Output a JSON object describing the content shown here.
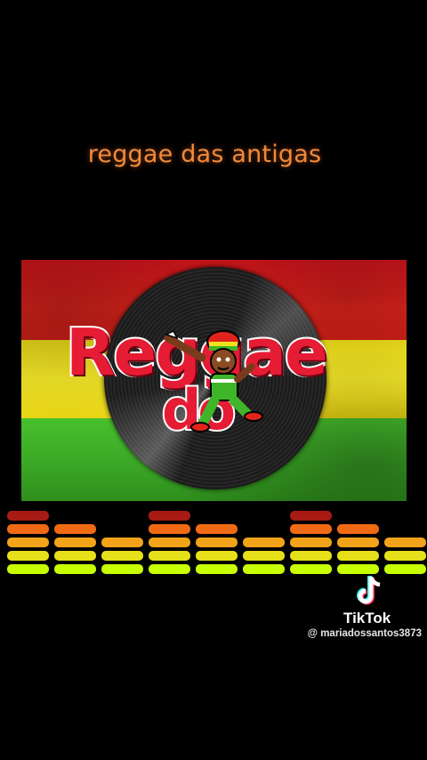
{
  "video": {
    "caption": "reggae das antigas"
  },
  "cover": {
    "logo_word": "Reggae",
    "logo_subword": "do",
    "flag_colors": [
      "#d41f1a",
      "#f2e01e",
      "#3fb52a"
    ],
    "vinyl_icon": "vinyl-record-icon",
    "mascot_icon": "rasta-dancer-mascot-icon"
  },
  "equalizer": {
    "levels": [
      5,
      4,
      3,
      5,
      4,
      3,
      5,
      4,
      3
    ],
    "segment_colors": [
      "#c8ff00",
      "#e6e01a",
      "#f2a31a",
      "#f06a14",
      "#e0241c"
    ]
  },
  "watermark": {
    "brand": "TikTok",
    "username": "@ mariadossantos3873",
    "icon": "tiktok-note-icon"
  }
}
